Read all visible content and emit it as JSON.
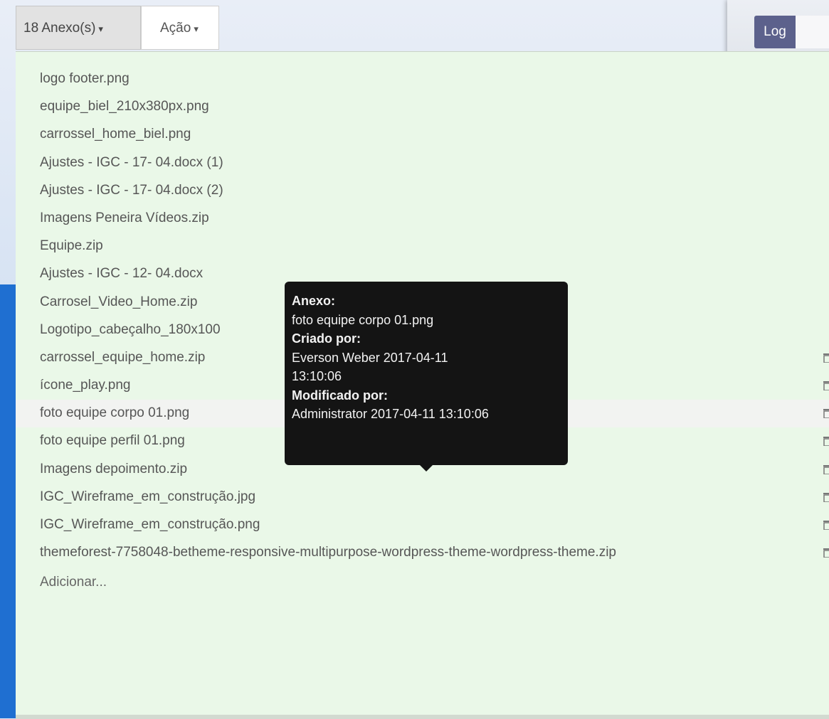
{
  "toolbar": {
    "attachments_label": "18 Anexo(s)",
    "action_label": "Ação"
  },
  "side_panel": {
    "log_label": "Log"
  },
  "attachments": [
    {
      "name": "logo footer.png"
    },
    {
      "name": "equipe_biel_210x380px.png"
    },
    {
      "name": "carrossel_home_biel.png"
    },
    {
      "name": "Ajustes - IGC - 17- 04.docx (1)"
    },
    {
      "name": "Ajustes - IGC - 17- 04.docx (2)"
    },
    {
      "name": "Imagens Peneira Vídeos.zip"
    },
    {
      "name": "Equipe.zip"
    },
    {
      "name": "Ajustes - IGC - 12- 04.docx"
    },
    {
      "name": "Carrosel_Video_Home.zip"
    },
    {
      "name": "Logotipo_cabeçalho_180x100"
    },
    {
      "name": "carrossel_equipe_home.zip"
    },
    {
      "name": "ícone_play.png"
    },
    {
      "name": "foto equipe corpo 01.png"
    },
    {
      "name": "foto equipe perfil 01.png"
    },
    {
      "name": "Imagens depoimento.zip"
    },
    {
      "name": "IGC_Wireframe_em_construção.jpg"
    },
    {
      "name": "IGC_Wireframe_em_construção.png"
    },
    {
      "name": "themeforest-7758048-betheme-responsive-multipurpose-wordpress-theme-wordpress-theme.zip"
    }
  ],
  "add_label": "Adicionar...",
  "tooltip": {
    "attachment_heading": "Anexo:",
    "attachment_name": "foto equipe corpo 01.png",
    "created_heading": "Criado por:",
    "created_line1": "Everson Weber 2017-04-11",
    "created_line2": "13:10:06",
    "modified_heading": "Modificado por:",
    "modified_value": "Administrator 2017-04-11 13:10:06"
  },
  "selected_index": 12,
  "colors": {
    "list_background": "#eaf8e8",
    "tooltip_background": "#141414",
    "log_button": "#5c618c"
  }
}
